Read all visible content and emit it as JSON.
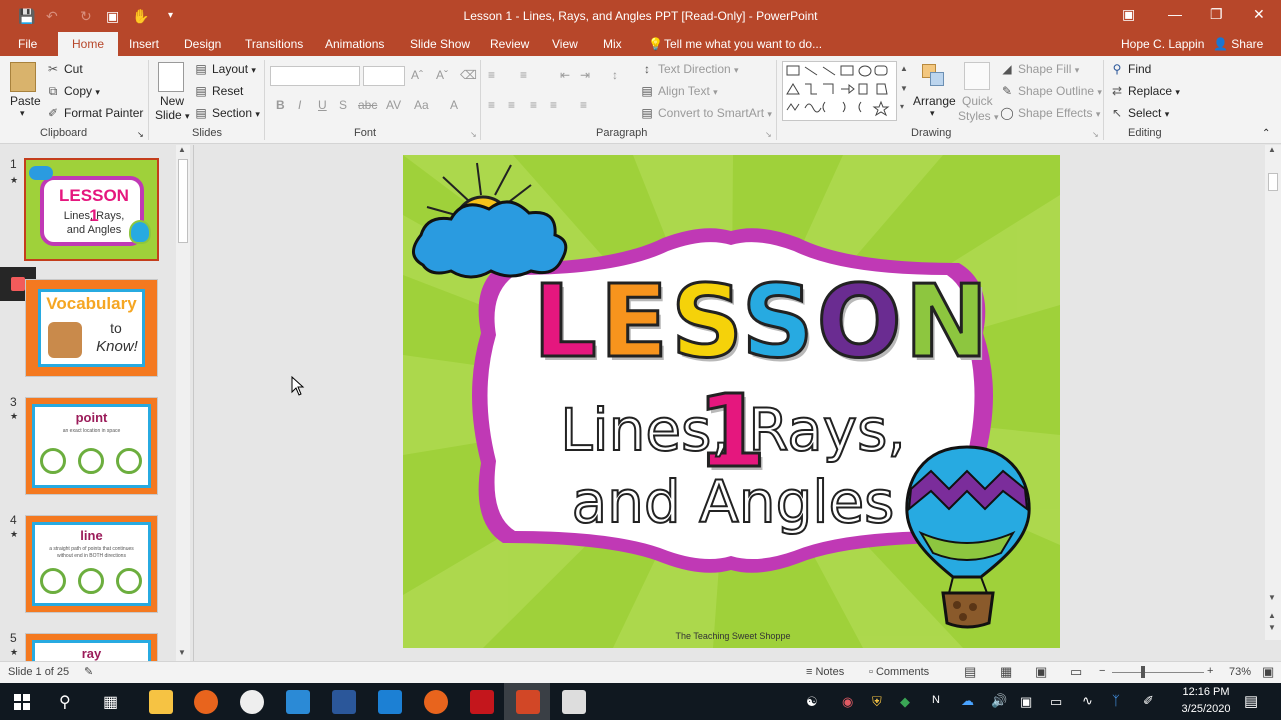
{
  "window": {
    "title": "Lesson 1 - Lines, Rays, and Angles PPT [Read-Only] - PowerPoint",
    "user": "Hope C. Lappin",
    "share": "Share"
  },
  "tabs": [
    "File",
    "Home",
    "Insert",
    "Design",
    "Transitions",
    "Animations",
    "Slide Show",
    "Review",
    "View",
    "Mix"
  ],
  "tell_me": "Tell me what you want to do...",
  "ribbon": {
    "clipboard": {
      "paste": "Paste",
      "cut": "Cut",
      "copy": "Copy",
      "format_painter": "Format Painter",
      "group": "Clipboard"
    },
    "slides": {
      "new_slide_1": "New",
      "new_slide_2": "Slide",
      "layout": "Layout",
      "reset": "Reset",
      "section": "Section",
      "group": "Slides"
    },
    "font": {
      "group": "Font"
    },
    "paragraph": {
      "text_direction": "Text Direction",
      "align_text": "Align Text",
      "convert": "Convert to SmartArt",
      "group": "Paragraph"
    },
    "drawing": {
      "arrange": "Arrange",
      "quick_1": "Quick",
      "quick_2": "Styles",
      "shape_fill": "Shape Fill",
      "shape_outline": "Shape Outline",
      "shape_effects": "Shape Effects",
      "group": "Drawing"
    },
    "editing": {
      "find": "Find",
      "replace": "Replace",
      "select": "Select",
      "group": "Editing"
    }
  },
  "thumbnails": [
    {
      "num": "1",
      "title": "LESSON 1",
      "sub1": "Lines, Rays,",
      "sub2": "and Angles"
    },
    {
      "num": "",
      "title": "Vocabulary",
      "sub1": "to",
      "sub2": "Know!"
    },
    {
      "num": "3",
      "title": "point",
      "sub1": "an exact location in space"
    },
    {
      "num": "4",
      "title": "line",
      "sub1": "a straight path of points that continues",
      "sub2": "without end in BOTH directions"
    },
    {
      "num": "5",
      "title": "ray"
    }
  ],
  "slide": {
    "title_letters": [
      "L",
      "E",
      "S",
      "S",
      "O",
      "N",
      " ",
      "1"
    ],
    "letter_colors": [
      "#e5177e",
      "#f7941d",
      "#f5d20a",
      "#27aae1",
      "#6a2c91",
      "#8dc63f",
      "#ffffff",
      "#e5177e"
    ],
    "line1": "Lines, Rays,",
    "line2": "and Angles",
    "credit": "The Teaching Sweet Shoppe"
  },
  "status": {
    "slide": "Slide 1 of 25",
    "notes": "Notes",
    "comments": "Comments",
    "zoom": "73%"
  },
  "taskbar": {
    "time": "12:16 PM",
    "date": "3/25/2020"
  },
  "colors": {
    "accent": "#b7472a",
    "slide_bg": "#9fd13a",
    "frame": "#c039b5"
  }
}
